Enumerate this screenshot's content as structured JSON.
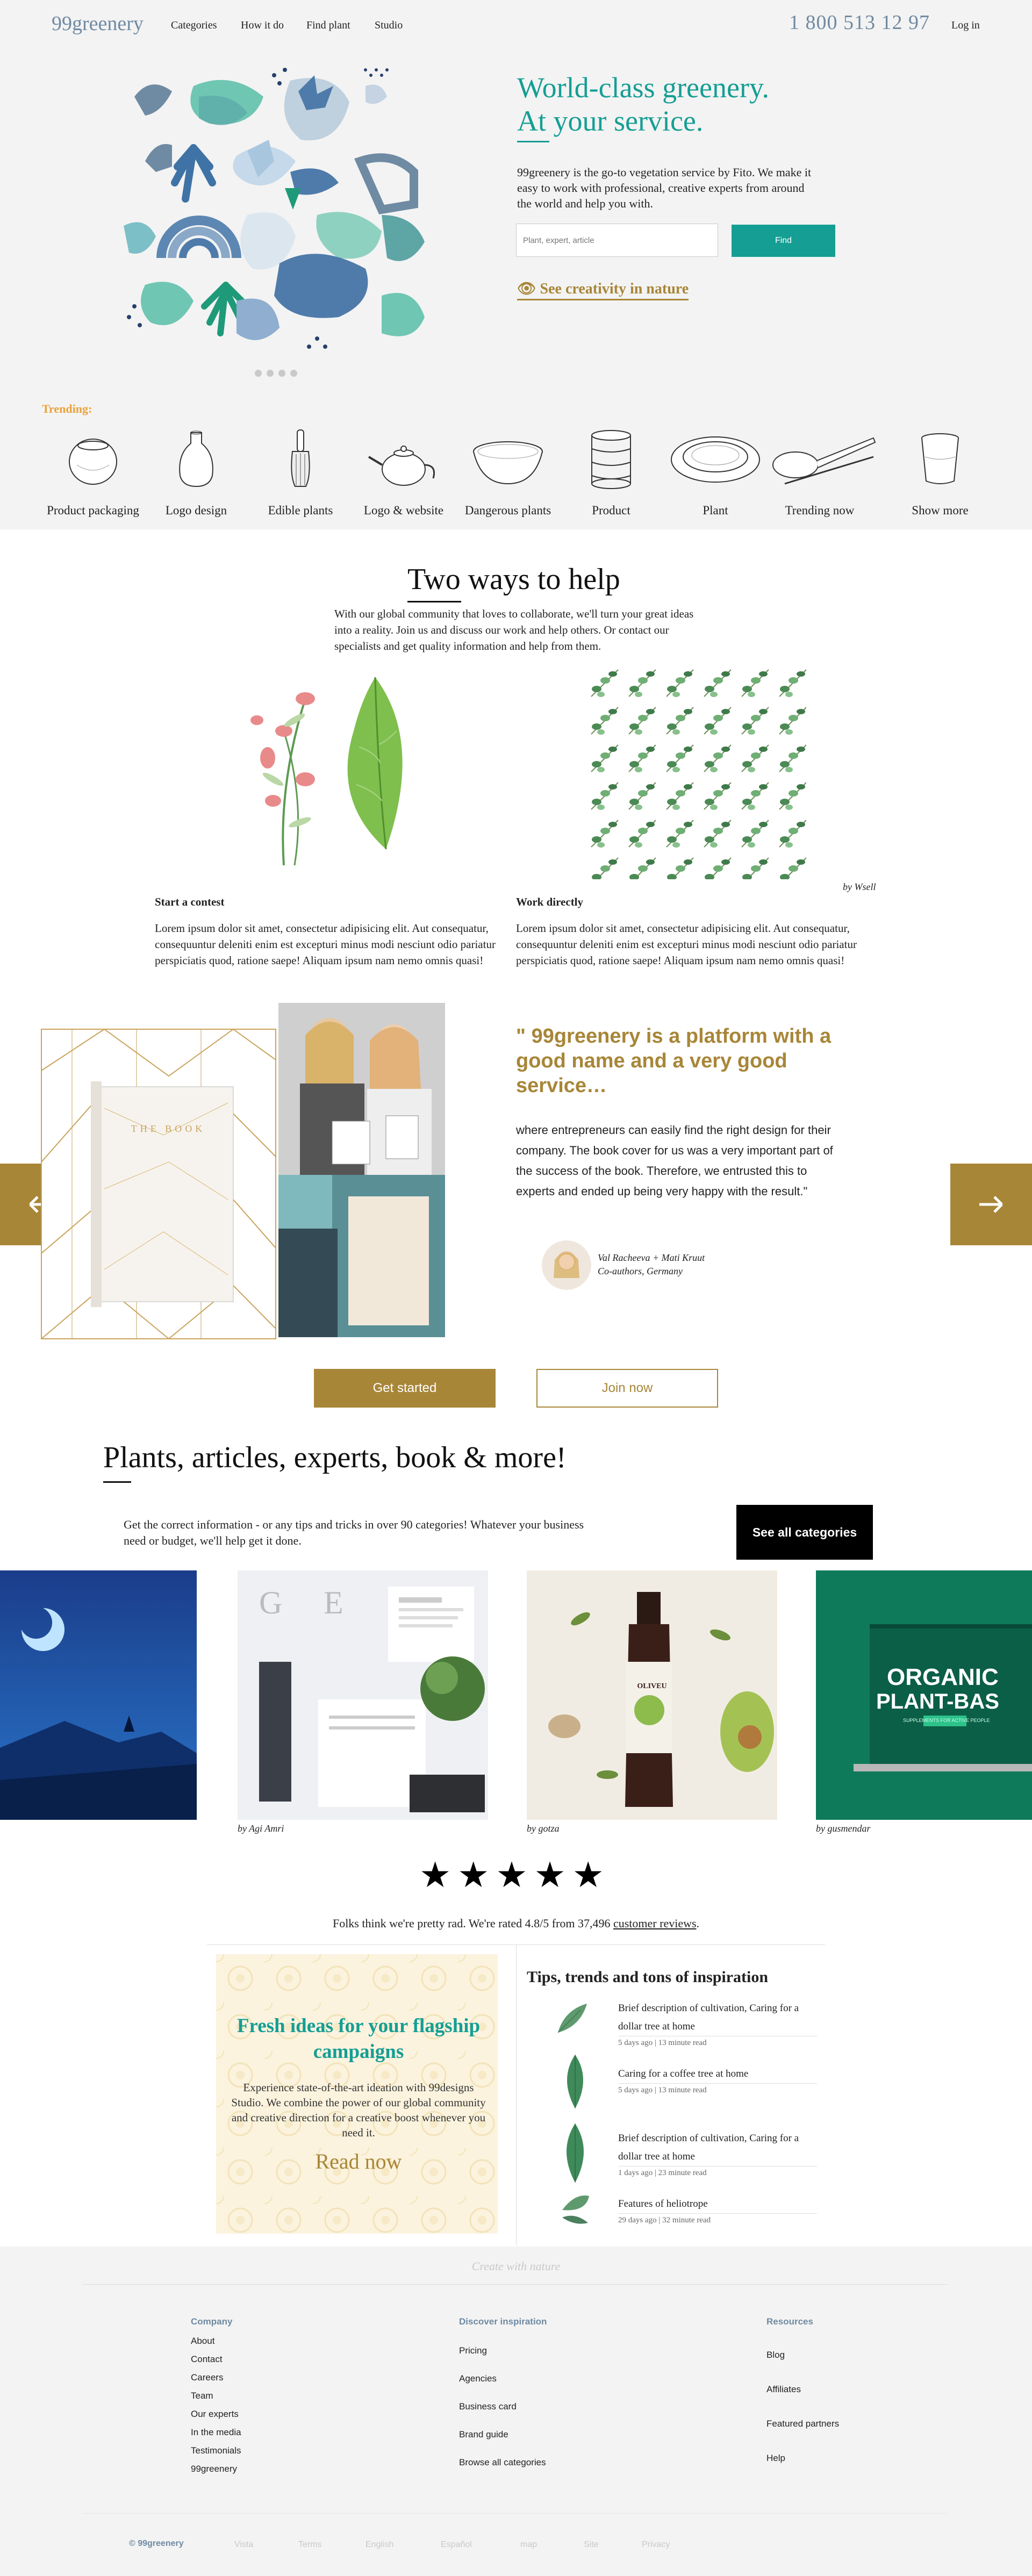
{
  "header": {
    "logo": "99greenery",
    "nav": [
      "Categories",
      "How it do",
      "Find plant",
      "Studio"
    ],
    "phone": "1 800 513 12 97",
    "login": "Log in"
  },
  "hero": {
    "title_line1": "World-class greenery.",
    "title_line2": "At your service.",
    "text": "99greenery is the go-to vegetation service by Fito. We make it easy to work with professional, creative experts from around the world and help you with.",
    "search_placeholder": "Plant, expert, article",
    "find_label": "Find",
    "creativity_link": "See creativity in nature"
  },
  "trending": {
    "label": "Trending:",
    "items": [
      {
        "label": "Product packaging",
        "icon": "bowl-icon"
      },
      {
        "label": "Logo design",
        "icon": "vase-icon"
      },
      {
        "label": "Edible plants",
        "icon": "whisk-icon"
      },
      {
        "label": "Logo & website",
        "icon": "teapot-icon"
      },
      {
        "label": "Dangerous plants",
        "icon": "wide-bowl-icon"
      },
      {
        "label": "Product",
        "icon": "stacked-jar-icon"
      },
      {
        "label": "Plant",
        "icon": "plate-icon"
      },
      {
        "label": "Trending now",
        "icon": "spoon-icon"
      },
      {
        "label": "Show more",
        "icon": "cup-icon"
      }
    ]
  },
  "two_ways": {
    "title": "Two ways to help",
    "text": "With our global community that loves to collaborate, we'll turn your great ideas into a reality. Join us and discuss our work and help others. Or contact our specialists and get quality information and help from them.",
    "image_credit": "by Wsell",
    "columns": [
      {
        "title": "Start a contest",
        "text": "Lorem ipsum dolor sit amet, consectetur adipisicing elit. Aut consequatur, consequuntur deleniti enim est excepturi minus modi nesciunt odio pariatur perspiciatis quod, ratione saepe! Aliquam ipsum nam nemo omnis quasi!"
      },
      {
        "title": "Work directly",
        "text": "Lorem ipsum dolor sit amet, consectetur adipisicing elit. Aut consequatur, consequuntur deleniti enim est excepturi minus modi nesciunt odio pariatur perspiciatis quod, ratione saepe! Aliquam ipsum nam nemo omnis quasi!"
      }
    ]
  },
  "testimonial": {
    "quote": "\" 99greenery is a platform with a good name and a very good service…",
    "text": "where entrepreneurs can easily find the right design for their company. The book cover for us was a very important part of the success of the book. Therefore, we entrusted this to experts and ended up being very happy with the result.\"",
    "author_name": "Val Racheeva + Mati Kruut",
    "author_role": "Co-authors, Germany",
    "book_title": "THE BOOK"
  },
  "cta": {
    "get_started": "Get started",
    "join_now": "Join now"
  },
  "plants": {
    "title": "Plants, articles, experts, book & more!",
    "text": "Get the correct information - or any tips and tricks in over 90 categories! Whatever your business need or budget, we'll help get it done.",
    "see_all": "See all categories",
    "cards": [
      {
        "credit": ""
      },
      {
        "credit": "by Agi Amri"
      },
      {
        "credit": "by gotza"
      },
      {
        "credit": "by gusmendar"
      }
    ],
    "bottle_label": "OLIVEU",
    "organic_line1": "ORGANIC",
    "organic_line2": "PLANT-BAS",
    "organic_sub": "SUPPLEMENTS FOR ACTIVE PEOPLE"
  },
  "rating": {
    "stars": "★★★★★",
    "text_before": "Folks think we're pretty rad. We're rated 4.8/5 from 37,496 ",
    "link": "customer reviews",
    "text_after": "."
  },
  "ideas": {
    "title": "Fresh ideas for your flagship campaigns",
    "text": "Experience state-of-the-art ideation with 99designs Studio. We combine the power of our global community and creative direction for a creative boost whenever you need it.",
    "read": "Read now"
  },
  "tips": {
    "title": "Tips, trends and tons of inspiration",
    "items": [
      {
        "title": "Brief description of cultivation, Caring for a dollar tree at home",
        "meta": "5 days ago | 13 minute read"
      },
      {
        "title": "Caring for a coffee tree at home",
        "meta": "5 days ago | 13 minute read"
      },
      {
        "title": "Brief description of cultivation, Caring for a dollar tree at home",
        "meta": "1 days ago | 23 minute read"
      },
      {
        "title": "Features of heliotrope",
        "meta": "29 days ago | 32 minute read"
      }
    ]
  },
  "footer": {
    "tagline": "Create with nature",
    "company": {
      "title": "Company",
      "links": [
        "About",
        "Contact",
        "Careers",
        "Team",
        "Our experts",
        "In the media",
        "Testimonials",
        "99greenery"
      ]
    },
    "discover": {
      "title": "Discover inspiration",
      "links": [
        "Pricing",
        "Agencies",
        "Business card",
        "Brand guide",
        "Browse all categories"
      ]
    },
    "resources": {
      "title": "Resources",
      "links": [
        "Blog",
        "Affiliates",
        "Featured partners",
        "Help"
      ]
    },
    "bottom": {
      "copyright": "© 99greenery",
      "links": [
        "Vista",
        "Terms",
        "English",
        "Español",
        "map",
        "Site",
        "Privacy"
      ]
    }
  },
  "colors": {
    "teal": "#159e94",
    "gold": "#a88638",
    "slate": "#6f8aa3",
    "orange": "#e9a23a"
  }
}
